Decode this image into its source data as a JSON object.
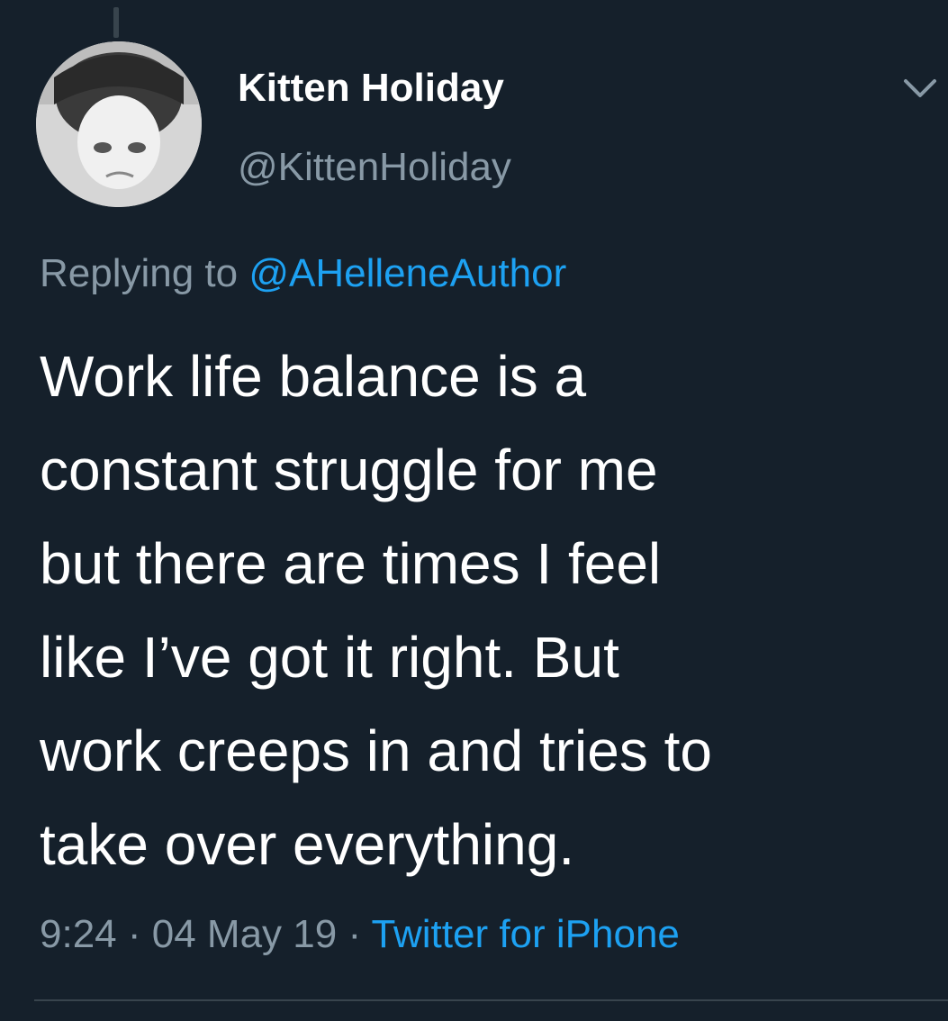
{
  "tweet": {
    "author": {
      "display_name": "Kitten Holiday",
      "handle": "@KittenHoliday"
    },
    "reply_prefix": "Replying to ",
    "reply_to": "@AHelleneAuthor",
    "body": "Work life balance is a\nconstant struggle for me\nbut there are times I feel\nlike I’ve got it right.  But\nwork creeps in and tries to\ntake over everything.",
    "time": "9:24",
    "date": "04 May 19",
    "separator": " · ",
    "source": "Twitter for iPhone"
  },
  "icons": {
    "menu": "chevron-down-icon",
    "avatar": "profile-photo"
  },
  "colors": {
    "background": "#15202b",
    "primary_text": "#ffffff",
    "secondary_text": "#8899a6",
    "accent": "#1da1f2",
    "divider": "#38444d"
  }
}
